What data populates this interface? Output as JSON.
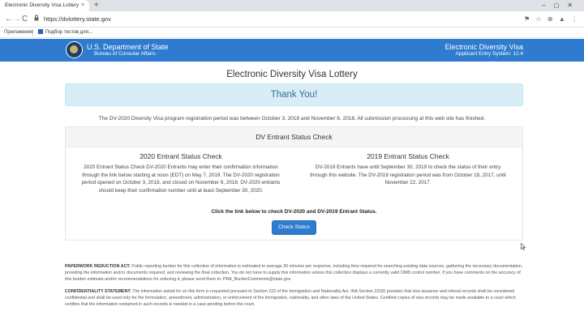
{
  "browser": {
    "tab_title": "Electronic Diversity Visa Lottery",
    "tab_close": "×",
    "new_tab": "+",
    "window_controls": "–◻✕",
    "back": "←",
    "forward": "→",
    "reload": "C",
    "lock": "🔒",
    "url": "https://dvlottery.state.gov",
    "extensions": "⚑ ☆ ⊕ ▲ ⋮",
    "bookmarks": [
      "Приложения",
      "Подбор тестов для..."
    ]
  },
  "header": {
    "department": "U.S. Department of State",
    "bureau": "Bureau of Consular Affairs",
    "app_name": "Electronic Diversity Visa",
    "system_version": "Applicant Entry System: 12.4"
  },
  "main": {
    "title": "Electronic Diversity Visa Lottery",
    "thank_you": "Thank You!",
    "registration_period": "The DV-2020 Diversity Visa program registration period was between October 3, 2018 and November 6, 2018. All submission processing at this web site has finished.",
    "status_panel": {
      "heading": "DV Entrant Status Check",
      "left_title": "2020 Entrant Status Check",
      "left_text": "2020 Entrant Status Check DV-2020 Entrants may enter their confirmation information through the link below starting at noon (EDT) on May 7, 2019. The DV-2020 registration period opened on October 3, 2018, and closed on November 6, 2018. DV-2020 entrants should keep their confirmation number until at least September 30, 2020.",
      "right_title": "2019 Entrant Status Check",
      "right_text": "DV-2019 Entrants have until September 30, 2019 to check the status of their entry through this website. The DV-2019 registration period was from October 18, 2017, until November 22, 2017.",
      "click_note": "Click the link below to check DV-2020 and DV-2019 Entrant Status.",
      "button_label": "Check Status"
    }
  },
  "fine_print": {
    "paperwork_label": "PAPERWORK REDUCTION ACT:",
    "paperwork_text": "Public reporting burden for this collection of information is estimated to average 30 minutes per response, including time required for searching existing data sources, gathering the necessary documentation, providing the information and/or documents required, and reviewing the final collection. You do not have to supply this information unless this collection displays a currently valid OMB control number. If you have comments on the accuracy of this burden estimate and/or recommendations for reducing it, please send them to: PRA_BurdenComments@state.gov",
    "confidentiality_label": "CONFIDENTIALITY STATEMENT:",
    "confidentiality_text": "The information asked for on this form is requested pursuant to Section 222 of the Immigration and Nationality Act. INA Section 222(f) provides that visa issuance and refusal records shall be considered confidential and shall be used only for the formulation, amendment, administration, or enforcement of the immigration, nationality, and other laws of the United States. Certified copies of visa records may be made available to a court which certifies that the information contained in such records is needed in a case pending before the court."
  },
  "colors": {
    "header_bg": "#2e7bcf",
    "alert_bg": "#d9edf7",
    "alert_text": "#31708f",
    "button_bg": "#2e7bcf"
  }
}
